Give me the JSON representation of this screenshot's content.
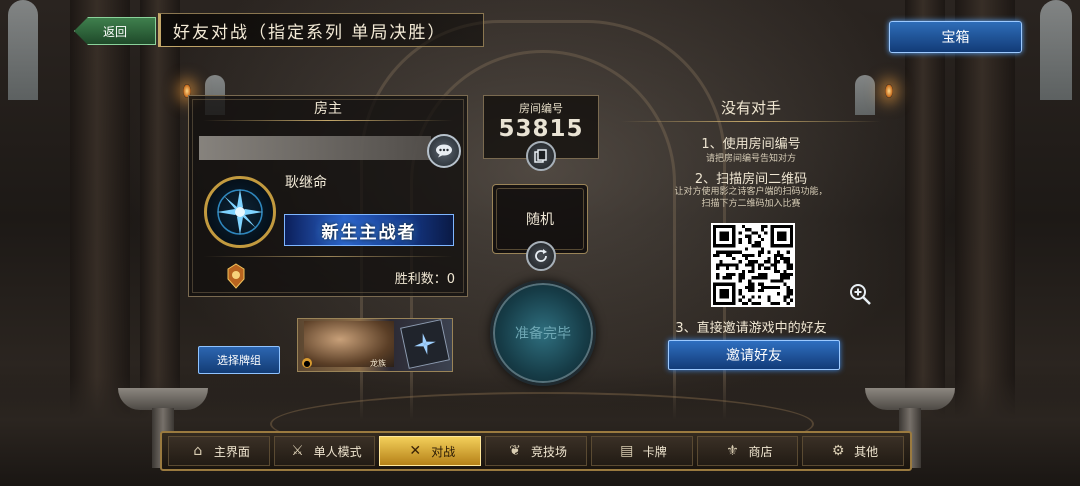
{
  "header": {
    "back_label": "返回",
    "title": "好友对战（指定系列 单局决胜）",
    "treasure_label": "宝箱"
  },
  "host": {
    "panel_title": "房主",
    "player_name": "耿继命",
    "rank": "新生主战者",
    "wins_label": "胜利数：0"
  },
  "deck": {
    "select_label": "选择牌组",
    "class_label": "龙族"
  },
  "room": {
    "label": "房间编号",
    "number": "53815",
    "random_label": "随机",
    "ready_label": "准备完毕"
  },
  "opponent": {
    "title": "没有对手",
    "step1": "1、使用房间编号",
    "step1_sub": "请把房间编号告知对方",
    "step2": "2、扫描房间二维码",
    "step2_sub_line1": "让对方使用影之诗客户端的扫码功能，",
    "step2_sub_line2": "扫描下方二维码加入比赛",
    "step3": "3、直接邀请游戏中的好友",
    "invite_label": "邀请好友"
  },
  "nav": {
    "items": [
      {
        "label": "主界面",
        "icon": "home-icon"
      },
      {
        "label": "单人模式",
        "icon": "sword-icon"
      },
      {
        "label": "对战",
        "icon": "crossed-swords-icon",
        "active": true
      },
      {
        "label": "竞技场",
        "icon": "laurel-icon"
      },
      {
        "label": "卡牌",
        "icon": "cards-icon"
      },
      {
        "label": "商店",
        "icon": "shop-icon"
      },
      {
        "label": "其他",
        "icon": "gear-icon"
      }
    ]
  },
  "colors": {
    "accent_gold": "#c5a86a",
    "button_blue": "#2f6fc0",
    "active_nav": "#f3cf5a"
  }
}
